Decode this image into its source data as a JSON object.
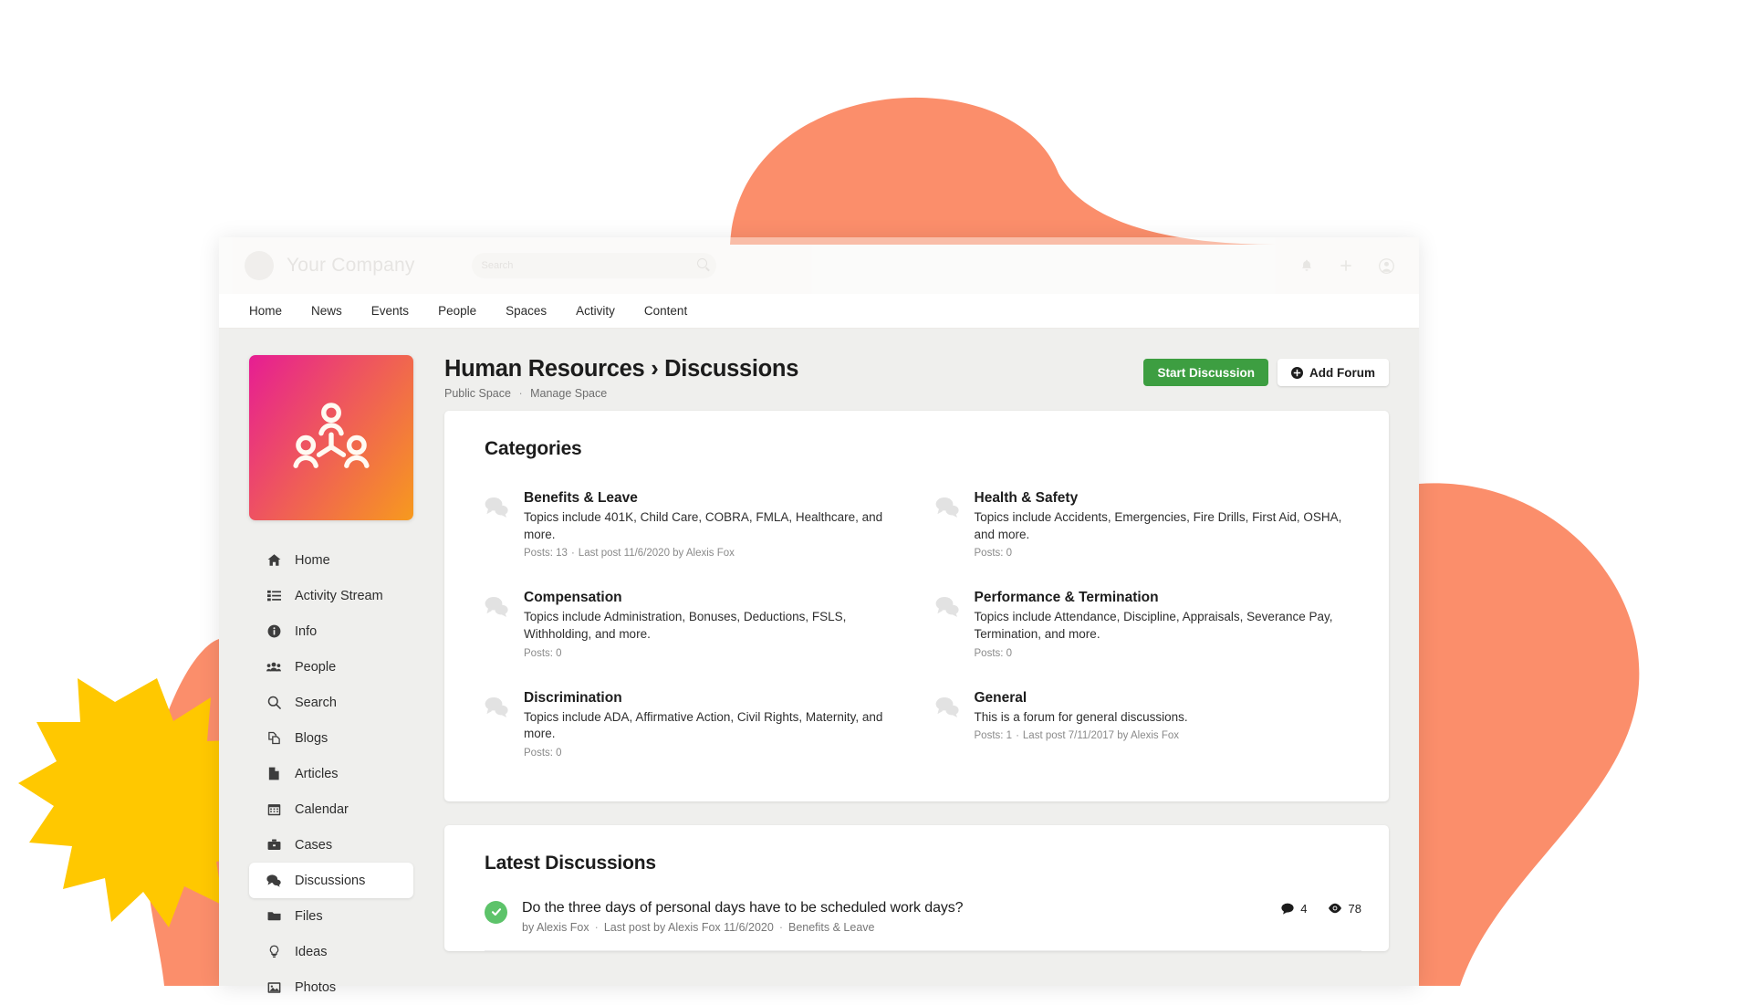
{
  "decor": {
    "orange": "#fb8e6b",
    "yellow": "#ffc800",
    "arc_label": "orange-dome",
    "blob_label": "orange-blob",
    "star_label": "yellow-starburst"
  },
  "brandbar": {
    "company_name": "Your Company",
    "search_placeholder": "Search",
    "icons": [
      "bell-icon",
      "plus-icon",
      "account-icon"
    ]
  },
  "topnav": {
    "items": [
      {
        "label": "Home"
      },
      {
        "label": "News"
      },
      {
        "label": "Events"
      },
      {
        "label": "People"
      },
      {
        "label": "Spaces"
      },
      {
        "label": "Activity"
      },
      {
        "label": "Content"
      }
    ]
  },
  "sidebar": {
    "logo_alt": "people-network-icon",
    "items": [
      {
        "label": "Home",
        "icon": "home-icon",
        "active": false
      },
      {
        "label": "Activity Stream",
        "icon": "list-icon",
        "active": false
      },
      {
        "label": "Info",
        "icon": "info-icon",
        "active": false
      },
      {
        "label": "People",
        "icon": "people-icon",
        "active": false
      },
      {
        "label": "Search",
        "icon": "search-icon",
        "active": false
      },
      {
        "label": "Blogs",
        "icon": "blogs-icon",
        "active": false
      },
      {
        "label": "Articles",
        "icon": "article-icon",
        "active": false
      },
      {
        "label": "Calendar",
        "icon": "calendar-icon",
        "active": false
      },
      {
        "label": "Cases",
        "icon": "briefcase-icon",
        "active": false
      },
      {
        "label": "Discussions",
        "icon": "discussion-icon",
        "active": true
      },
      {
        "label": "Files",
        "icon": "folder-icon",
        "active": false
      },
      {
        "label": "Ideas",
        "icon": "lightbulb-icon",
        "active": false
      },
      {
        "label": "Photos",
        "icon": "photo-icon",
        "active": false
      }
    ]
  },
  "page": {
    "title": "Human Resources › Discussions",
    "sub_space": "Public Space",
    "sub_sep": "·",
    "sub_manage": "Manage Space",
    "start_discussion_label": "Start Discussion",
    "add_forum_label": "Add Forum",
    "green": "#3d9e41"
  },
  "categories": {
    "heading": "Categories",
    "items": [
      {
        "name": "Benefits & Leave",
        "desc": "Topics include 401K, Child Care, COBRA, FMLA, Healthcare, and more.",
        "posts": "Posts: 13",
        "sep": "·",
        "lastpost": "Last post 11/6/2020 by Alexis Fox"
      },
      {
        "name": "Health & Safety",
        "desc": "Topics include Accidents, Emergencies, Fire Drills, First Aid, OSHA, and more.",
        "posts": "Posts: 0",
        "sep": "",
        "lastpost": ""
      },
      {
        "name": "Compensation",
        "desc": "Topics include Administration, Bonuses, Deductions, FSLS, Withholding, and more.",
        "posts": "Posts: 0",
        "sep": "",
        "lastpost": ""
      },
      {
        "name": "Performance & Termination",
        "desc": "Topics include Attendance, Discipline, Appraisals, Severance Pay, Termination, and more.",
        "posts": "Posts: 0",
        "sep": "",
        "lastpost": ""
      },
      {
        "name": "Discrimination",
        "desc": "Topics include ADA, Affirmative Action, Civil Rights, Maternity, and more.",
        "posts": "Posts: 0",
        "sep": "",
        "lastpost": ""
      },
      {
        "name": "General",
        "desc": "This is a forum for general discussions.",
        "posts": "Posts: 1",
        "sep": "·",
        "lastpost": "Last post 7/11/2017 by Alexis Fox"
      }
    ]
  },
  "latest": {
    "heading": "Latest Discussions",
    "items": [
      {
        "title": "Do the three days of personal days have to be scheduled work days?",
        "author": "by Alexis Fox",
        "sep1": "·",
        "lastpost": "Last post by Alexis Fox 11/6/2020",
        "sep2": "·",
        "category": "Benefits & Leave",
        "replies": "4",
        "views": "78"
      }
    ]
  }
}
